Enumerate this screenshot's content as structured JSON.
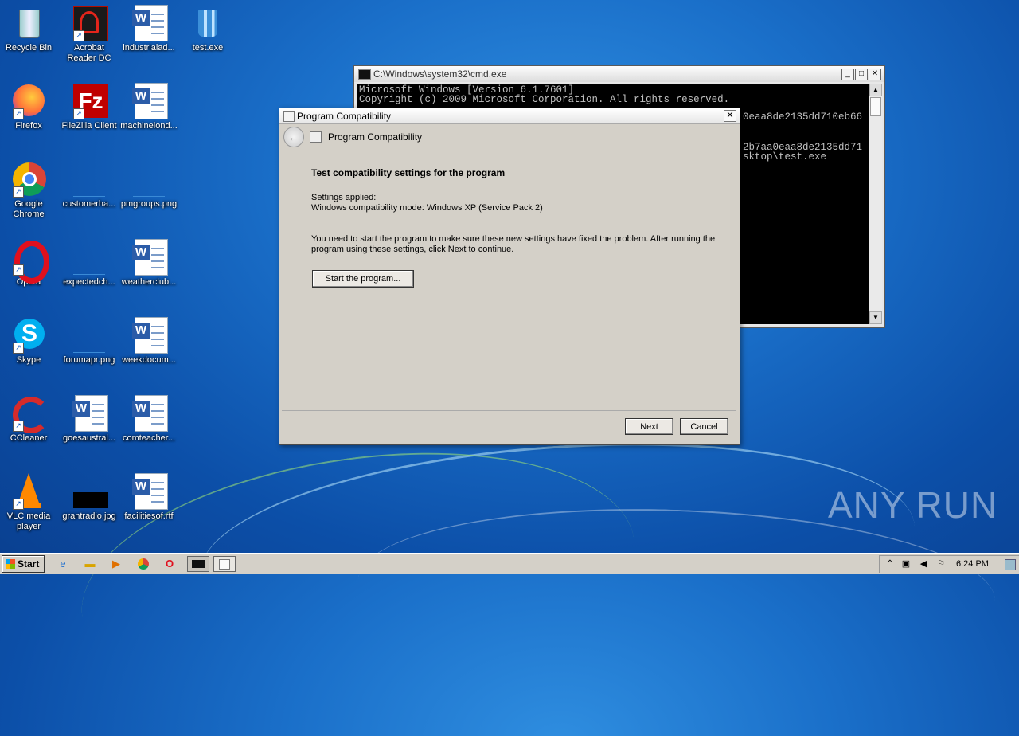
{
  "desktop": {
    "icons": [
      {
        "label": "Recycle Bin",
        "icon": "recycle-bin-icon"
      },
      {
        "label": "Acrobat Reader DC",
        "icon": "acrobat-icon"
      },
      {
        "label": "industrialad...",
        "icon": "word-doc-icon"
      },
      {
        "label": "test.exe",
        "icon": "exe-icon"
      },
      {
        "label": "Firefox",
        "icon": "firefox-icon"
      },
      {
        "label": "FileZilla Client",
        "icon": "filezilla-icon"
      },
      {
        "label": "machinelond...",
        "icon": "word-doc-icon"
      },
      {
        "label": "Google Chrome",
        "icon": "chrome-icon"
      },
      {
        "label": "customerha...",
        "icon": "image-icon"
      },
      {
        "label": "pmgroups.png",
        "icon": "image-icon"
      },
      {
        "label": "Opera",
        "icon": "opera-icon"
      },
      {
        "label": "expectedch...",
        "icon": "image-icon"
      },
      {
        "label": "weatherclub...",
        "icon": "word-doc-icon"
      },
      {
        "label": "Skype",
        "icon": "skype-icon"
      },
      {
        "label": "forumapr.png",
        "icon": "image-icon"
      },
      {
        "label": "weekdocum...",
        "icon": "word-doc-icon"
      },
      {
        "label": "CCleaner",
        "icon": "ccleaner-icon"
      },
      {
        "label": "goesaustral...",
        "icon": "word-doc-icon"
      },
      {
        "label": "comteacher...",
        "icon": "word-doc-icon"
      },
      {
        "label": "VLC media player",
        "icon": "vlc-icon"
      },
      {
        "label": "grantradio.jpg",
        "icon": "image-icon"
      },
      {
        "label": "facilitiesof.rtf",
        "icon": "word-doc-icon"
      }
    ]
  },
  "cmd": {
    "title": "C:\\Windows\\system32\\cmd.exe",
    "lines": [
      "Microsoft Windows [Version 6.1.7601]",
      "Copyright (c) 2009 Microsoft Corporation.  All rights reserved."
    ],
    "peek_lines": [
      "0eaa8de2135dd710eb66",
      "2b7aa0eaa8de2135dd71",
      "sktop\\test.exe"
    ]
  },
  "dialog": {
    "title": "Program Compatibility",
    "header_title": "Program Compatibility",
    "heading": "Test compatibility settings for the program",
    "settings_label": "Settings applied:",
    "settings_value": "Windows compatibility mode: Windows XP (Service Pack 2)",
    "instructions": "You need to start the program to make sure these new settings have fixed the problem. After running the program using these settings, click Next to continue.",
    "start_button": "Start the program...",
    "next_button": "Next",
    "cancel_button": "Cancel"
  },
  "taskbar": {
    "start_label": "Start",
    "clock": "6:24 PM"
  },
  "watermark": "ANY RUN"
}
